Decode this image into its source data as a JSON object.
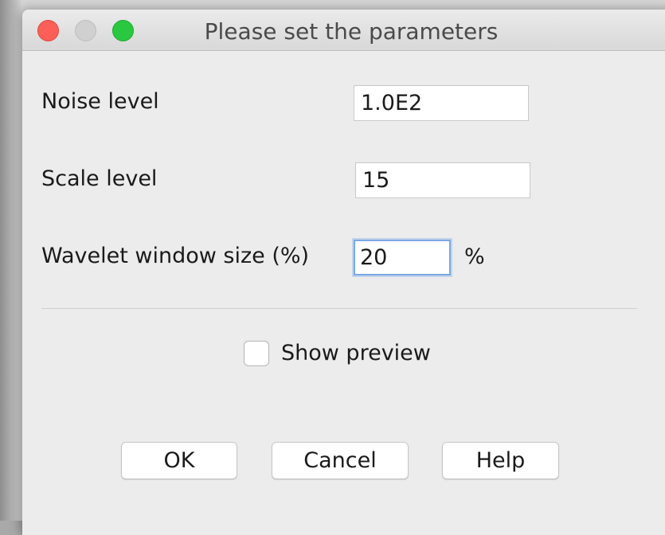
{
  "window": {
    "title": "Please set the parameters"
  },
  "form": {
    "noise_level": {
      "label": "Noise level",
      "value": "1.0E2"
    },
    "scale_level": {
      "label": "Scale level",
      "value": "15"
    },
    "wavelet_window_size": {
      "label": "Wavelet window size (%)",
      "value": "20",
      "unit": "%"
    }
  },
  "preview": {
    "label": "Show preview",
    "checked": false
  },
  "buttons": {
    "ok": "OK",
    "cancel": "Cancel",
    "help": "Help"
  },
  "colors": {
    "close": "#fc5f57",
    "minimize_inactive": "#d0d0d0",
    "maximize": "#2ac840",
    "focus_ring": "#7aa9e6"
  }
}
